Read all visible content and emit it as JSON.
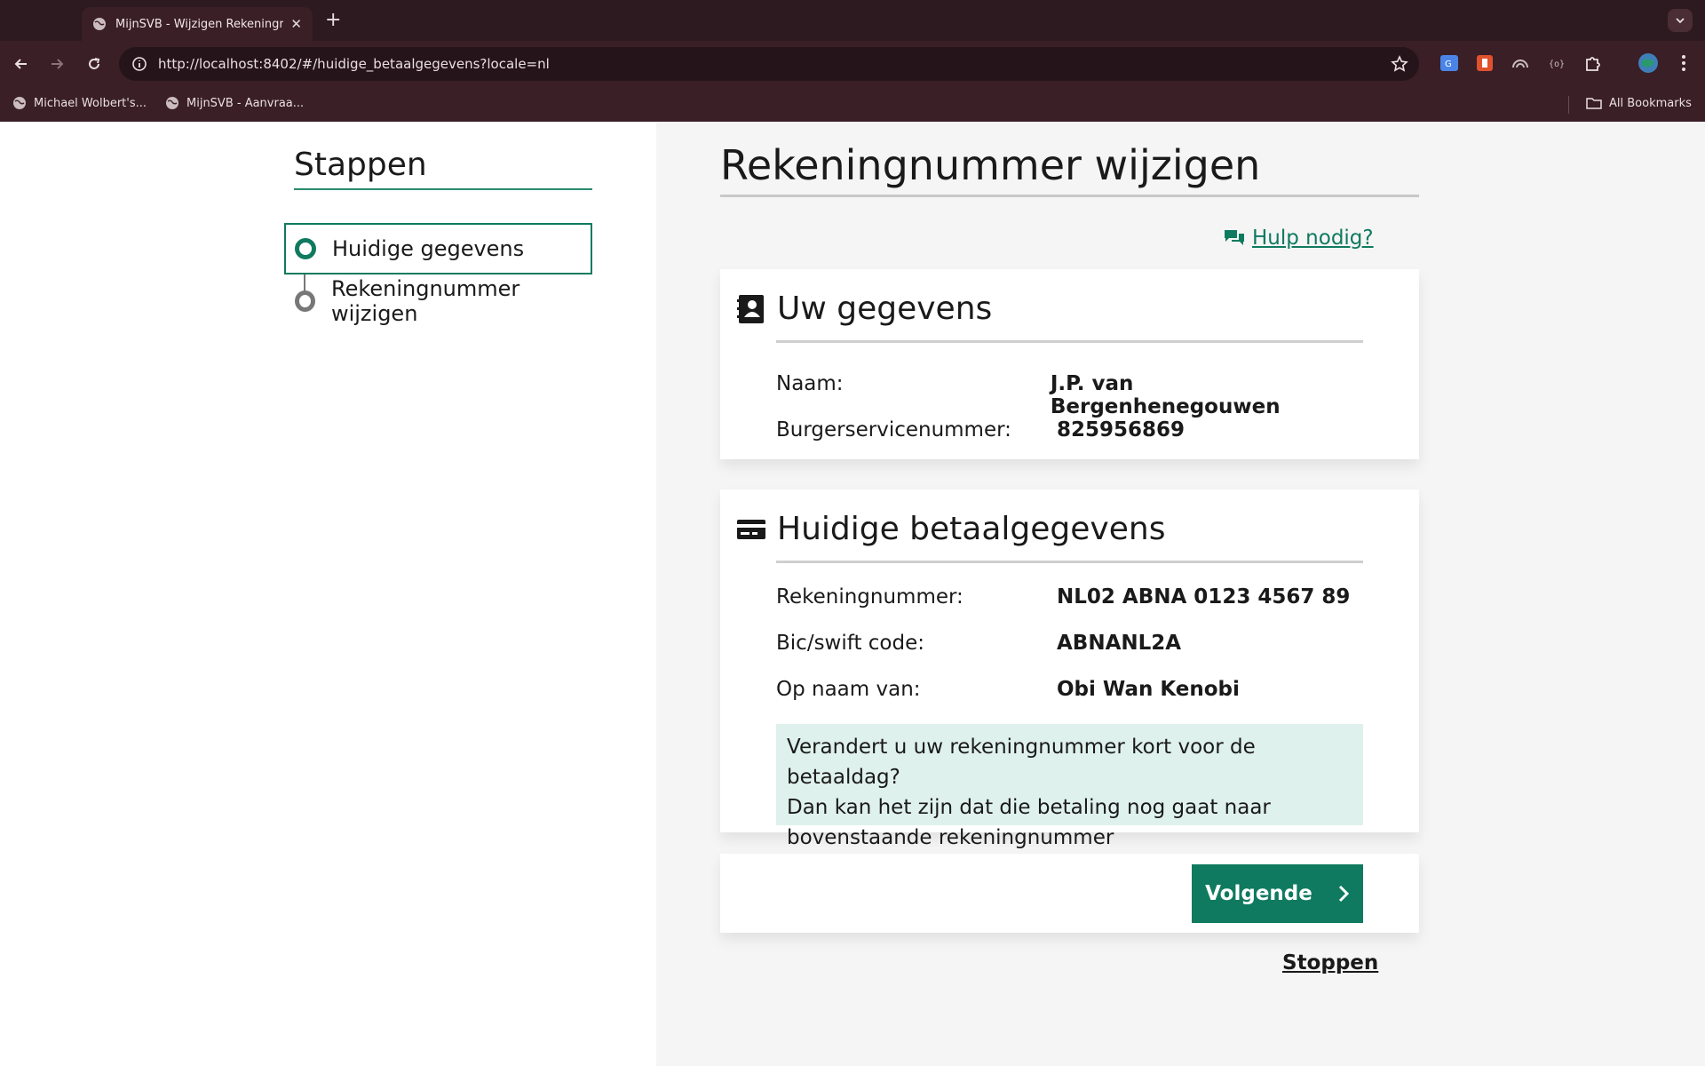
{
  "browser": {
    "tab_title": "MijnSVB - Wijzigen Rekeningr",
    "tab_close": "✕",
    "new_tab": "+",
    "url": "http://localhost:8402/#/huidige_betaalgegevens?locale=nl",
    "bookmarks": [
      {
        "label": "Michael Wolbert's..."
      },
      {
        "label": "MijnSVB - Aanvraa..."
      }
    ],
    "all_bookmarks": "All Bookmarks"
  },
  "sidebar": {
    "title": "Stappen",
    "steps": [
      {
        "label": "Huidige gegevens",
        "state": "active"
      },
      {
        "label": "Rekeningnummer wijzigen",
        "state": "pending"
      }
    ]
  },
  "main": {
    "title": "Rekeningnummer wijzigen",
    "help_link": "Hulp nodig?",
    "personal": {
      "heading": "Uw gegevens",
      "rows": [
        {
          "label": "Naam:",
          "value": "J.P. van Bergenhenegouwen"
        },
        {
          "label": "Burgerservicenummer:",
          "value": "825956869"
        }
      ]
    },
    "payment": {
      "heading": "Huidige betaalgegevens",
      "rows": [
        {
          "label": "Rekeningnummer:",
          "value": "NL02 ABNA 0123 4567 89"
        },
        {
          "label": "Bic/swift code:",
          "value": "ABNANL2A"
        },
        {
          "label": "Op naam van:",
          "value": "Obi Wan Kenobi"
        }
      ],
      "notice_lines": [
        "Verandert u uw rekeningnummer kort voor de betaaldag?",
        "Dan kan het zijn dat die betaling nog gaat naar",
        "bovenstaande rekeningnummer"
      ]
    },
    "next_button": "Volgende",
    "stop_link": "Stoppen"
  },
  "colors": {
    "accent": "#0f7a5f",
    "notice_bg": "#dff1ec",
    "chrome_bg": "#3a1f26"
  }
}
